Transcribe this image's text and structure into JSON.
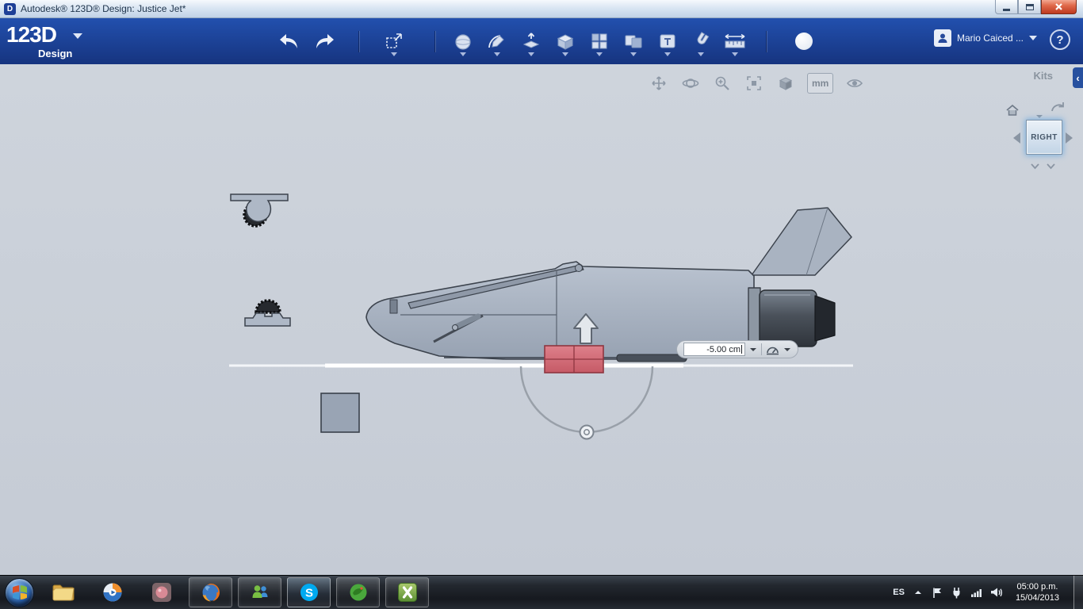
{
  "window": {
    "title": "Autodesk® 123D® Design: Justice Jet*"
  },
  "header": {
    "logo_main": "123D",
    "logo_sub": "Design",
    "user_name": "Mario Caiced ...",
    "help_label": "?",
    "tool_icon_names": [
      "undo",
      "redo",
      "transform",
      "primitives",
      "sketch",
      "construct",
      "modify",
      "pattern",
      "combine",
      "text",
      "snap",
      "measure",
      "material-ball"
    ]
  },
  "view_toolbar": {
    "units_label": "mm",
    "icon_names": [
      "pan",
      "orbit",
      "zoom",
      "fit-view",
      "shaded-view",
      "units",
      "visibility-eye"
    ]
  },
  "kits_panel": {
    "label": "Kits",
    "collapse_glyph": "‹"
  },
  "viewcube": {
    "face_label": "RIGHT"
  },
  "scene": {
    "dimension_input": {
      "value": "-5.00 cm"
    }
  },
  "taskbar": {
    "language_label": "ES",
    "clock": {
      "time": "05:00 p.m.",
      "date": "15/04/2013"
    },
    "app_icon_names": [
      "start",
      "explorer-folder",
      "media-player",
      "pink-app",
      "firefox",
      "messenger",
      "skype",
      "green-app",
      "excel"
    ]
  }
}
